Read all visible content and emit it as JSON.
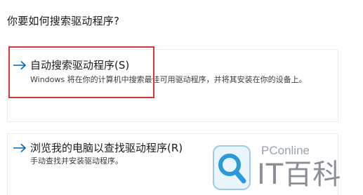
{
  "dialog": {
    "question": "你要如何搜索驱动程序?"
  },
  "options": [
    {
      "title": "自动搜索驱动程序(S)",
      "description": "Windows 将在你的计算机中搜索最佳可用驱动程序，并将其安装在你的设备上。",
      "icon": "arrow-right-icon"
    },
    {
      "title": "浏览我的电脑以查找驱动程序(R)",
      "description": "手动查找并安装驱动程序。",
      "icon": "arrow-right-icon"
    }
  ],
  "watermark": {
    "site": "PConline",
    "brand": "IT百科"
  },
  "colors": {
    "accent": "#0067c0",
    "highlight_box": "#d23a3a",
    "watermark": "#8a8f96"
  }
}
